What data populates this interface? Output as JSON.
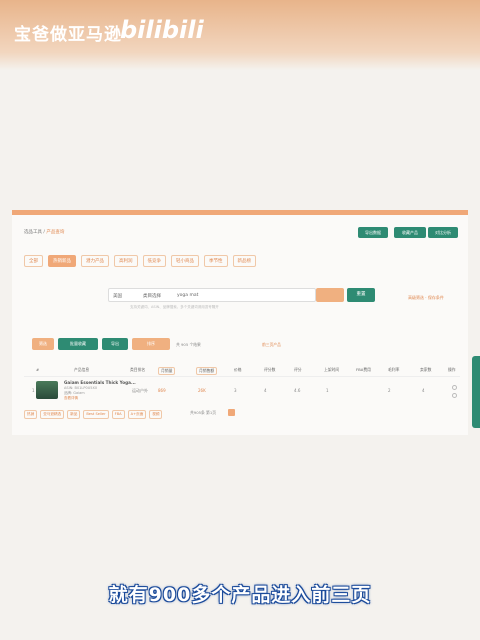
{
  "brand": {
    "title": "宝爸做亚马逊",
    "logo_text": "bilibili"
  },
  "breadcrumb": {
    "parent": "选品工具",
    "current": "产品查询"
  },
  "toolbar": [
    "导出数据",
    "收藏产品",
    "对比分析"
  ],
  "tabs": [
    "全部",
    "热销新品",
    "潜力产品",
    "高利润",
    "低竞争",
    "轻小商品",
    "季节性",
    "新品榜"
  ],
  "search": {
    "site_label": "美国",
    "category_label": "类目选择",
    "query": "yoga mat",
    "reset_label": "重置",
    "advanced_link": "高级筛选 · 保存条件",
    "hint": "支持关键词、ASIN、品牌搜索，多个关键词请用逗号隔开"
  },
  "actions": {
    "buttons": [
      "筛选",
      "批量收藏",
      "导出",
      "排序"
    ],
    "meta_text": "共 905 个结果",
    "meta_extra": "前三页产品"
  },
  "table": {
    "headers": [
      "#",
      "产品信息",
      "类目排名",
      "月销量",
      "月销售额",
      "价格",
      "评分数",
      "评分",
      "上架时间",
      "FBA费用",
      "毛利率",
      "卖家数",
      "操作"
    ],
    "row": {
      "index": "1",
      "name": "Gaiam Essentials Thick Yoga...",
      "sub1": "ASIN: B01LP0U5X0",
      "sub2": "品牌: Gaiam",
      "sub3": "查看详情",
      "rank": "运动户外",
      "sales": "869",
      "revenue": "26K",
      "c1": "3",
      "c2": "4",
      "c3": "4.6",
      "c4": "1",
      "c5": "2",
      "c6": "4"
    },
    "tags": [
      "热销",
      "亚马逊精选",
      "新品",
      "Best Seller",
      "FBA",
      "A+页面",
      "视频",
      "品牌旗舰"
    ],
    "pager": "共905条  第1页"
  },
  "subtitle": "就有900多个产品进入前三页",
  "colors": {
    "accent": "#f0a878",
    "primary": "#2e8b73",
    "subtitle_stroke": "#1a4a9a"
  }
}
